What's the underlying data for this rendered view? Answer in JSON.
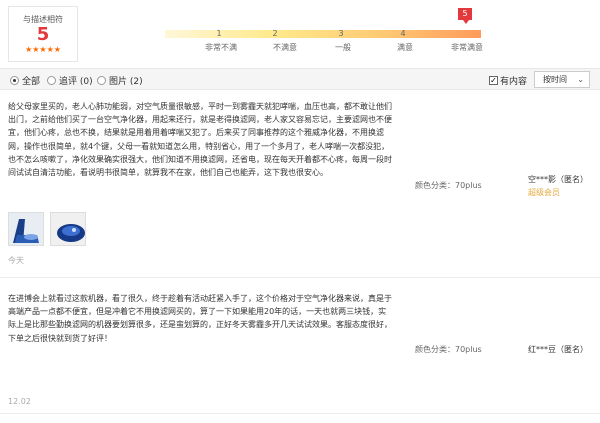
{
  "rating": {
    "title": "与描述相符",
    "score": "5",
    "stars": "★★★★★"
  },
  "scale": {
    "numbers": [
      "1",
      "2",
      "3",
      "4"
    ],
    "labels": [
      "非常不满",
      "不满意",
      "一般",
      "满意",
      "非常满意"
    ],
    "selected": "5"
  },
  "filters": {
    "all": "全部",
    "followup": "追评 (0)",
    "images": "图片 (2)",
    "has_content": "有内容",
    "sort": "按时间"
  },
  "reviews": [
    {
      "text": "给父母家里买的，老人心肺功能弱，对空气质量很敏感，平时一到雾霾天就犯哮喘，血压也高，都不敢让他们出门，之前给他们买了一台空气净化器，用起来还行，就是老得换滤网，老人家又容易忘记，主要滤网也不便宜，他们心疼，总也不换，结果就是用着用着哮喘又犯了。后来买了同事推荐的这个雅威净化器，不用换滤网，操作也很简单，就4个键，父母一看就知道怎么用，特别省心，用了一个多月了，老人哮喘一次都没犯，也不怎么咳嗽了，净化效果确实很强大，他们知道不用换滤网，还省电，现在每天开着都不心疼，每周一段时间试试自清洁功能，看说明书很简单，就算我不在家，他们自己也能弄，这下我也很安心。",
      "attr": "颜色分类：70plus",
      "user": "空***影（匿名）",
      "level": "超级会员",
      "date": "今天"
    },
    {
      "text": "在进博会上就看过这款机器，看了很久，终于趁着有活动赶紧入手了，这个价格对于空气净化器来说，真是于高端产品一点都不便宜，但是冲着它不用换滤网买的，算了一下如果能用20年的话，一天也就两三块钱，实际上是比那些勤换滤网的机器要划算很多，还是蛮划算的，正好冬天雾霾多开几天试试效果。客服态度很好，下单之后很快就到货了好评！",
      "attr": "颜色分类：70plus",
      "user": "红***豆（匿名）",
      "date": "12.02"
    }
  ],
  "colors": {
    "accent_red": "#e4393c",
    "star_orange": "#ff6a00",
    "vip_gold": "#e4a93c"
  },
  "icons": {
    "chevron": "chevron-down-icon",
    "check": "checkbox-icon",
    "radio": "radio-icon"
  }
}
